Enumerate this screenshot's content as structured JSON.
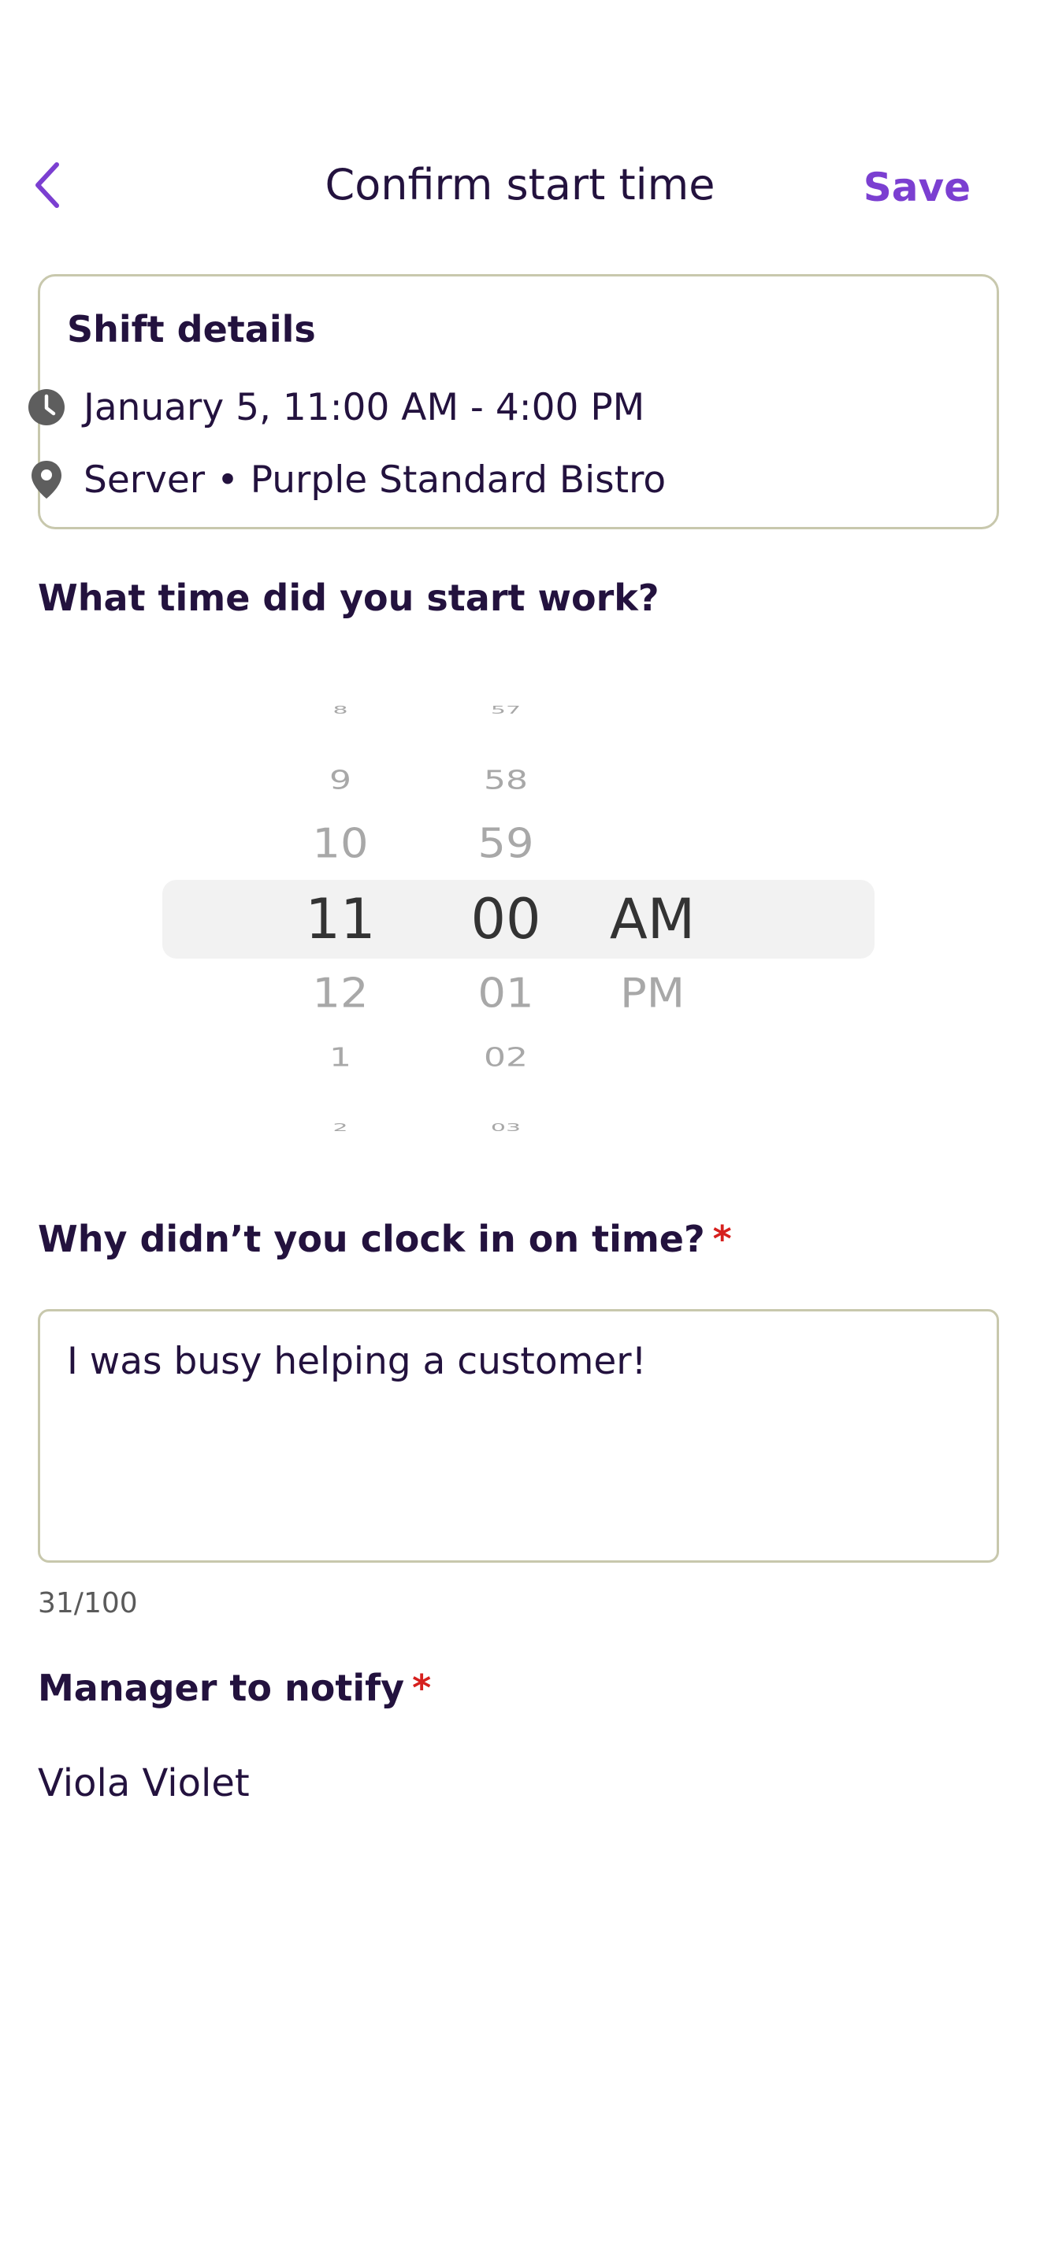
{
  "header": {
    "title": "Confirm start time",
    "save_label": "Save"
  },
  "shift_details": {
    "title": "Shift details",
    "time_range": "January 5, 11:00 AM - 4:00 PM",
    "role_location": "Server • Purple Standard Bistro"
  },
  "start_time": {
    "question": "What time did you start work?",
    "hours": [
      "8",
      "9",
      "10",
      "11",
      "12",
      "1",
      "2"
    ],
    "minutes": [
      "57",
      "58",
      "59",
      "00",
      "01",
      "02",
      "03"
    ],
    "periods": [
      "AM",
      "PM"
    ],
    "selected": {
      "hour": "11",
      "minute": "00",
      "period": "AM"
    }
  },
  "reason": {
    "question": "Why didn’t you clock in on time?",
    "required_marker": "*",
    "value": "I was busy helping a customer!",
    "char_count": "31/100"
  },
  "manager": {
    "question": "Manager to notify",
    "required_marker": "*",
    "value": "Viola Violet"
  },
  "colors": {
    "accent": "#7b3fd1",
    "text": "#23123e",
    "required": "#d6201e",
    "border": "#c8c8ad",
    "icon": "#5e5e5e"
  }
}
